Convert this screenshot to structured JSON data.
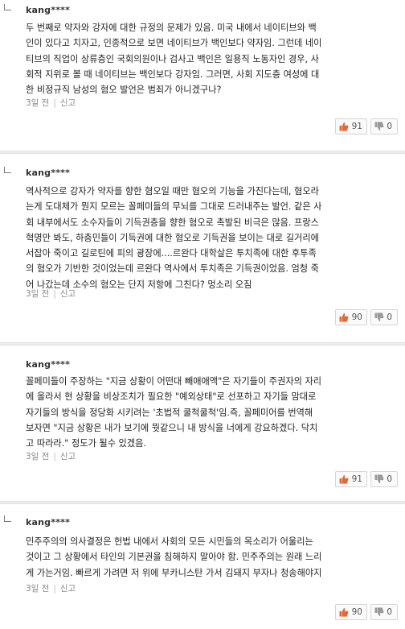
{
  "comments": [
    {
      "author": "kang****",
      "lines": [
        "두 번째로 약자와 강자에 대한 규정의 문제가 있음. 미국 내에서 네이티브와 백",
        "인이 있다고 치자고, 인종적으로 보면 네이티브가 백인보다 약자임. 그런데 네이",
        "티브의 직업이 상류층인 국회의원이나 검사고 백인은 일용직 노동자인 경우, 사",
        "회적 지위로 볼 때 네이티브는 백인보다 강자임. 그러면, 사회 지도층 여성에 대",
        "한 비정규직 남성의 혐오 발언은 범죄가 아니겠구나?"
      ],
      "time": "3일 전",
      "report": "신고",
      "likes": "91",
      "dislikes": "0"
    },
    {
      "author": "kang****",
      "lines": [
        "역사적으로 강자가 약자를 향한 혐오일 때만 혐오의 기능을 가진다는데, 혐오라",
        "는게 도대체가 뭔지 모르는 꼴페미들의 무뇌를 그대로 드러내주는 발언. 같은 사",
        "회 내부에서도 소수자들이 기득권층을 향한 혐오로 촉발된 비극은 많음. 프랑스",
        "혁명만 봐도, 하층민들이 기득권에 대한 혐오로 기득권을 보이는 대로 길거리에",
        "서잡아 죽이고 길로틴에 피의 광장에....르완다 대학살은 투치족에 대한 후투족",
        "의 혐오가 기반한 것이었는데 르완다 역사에서 투치족은 기득권이었음. 엄청 죽",
        "어 나갔는데 소수의 혐오는 단지 저항에 그친다? 멍소리 오짐"
      ],
      "time": "3일 전",
      "report": "신고",
      "likes": "90",
      "dislikes": "0"
    },
    {
      "author": "kang****",
      "lines": [
        "꼴페미들이 주장하는 \"지금 상황이 어떤대 빼애애액\"은 자기들이 주권자의 자리",
        "에 올라서 현 상황을 비상조치가 필요한 \"예외상태\"로 선포하고 자기들 맘대로",
        "자기들의 방식을 정당화 시키려는 '초법적 쿨척쿨척'임.즉, 꼴페미어를 번역해",
        "보자면 \"지금 상황은 내가 보기에 뭣같으니 내 방식을 너에게 강요하겠다. 닥치",
        "고 따라라.\" 정도가 될수 있겠음."
      ],
      "time": "3일 전",
      "report": "신고",
      "likes": "91",
      "dislikes": "0"
    },
    {
      "author": "kang****",
      "lines": [
        "민주주의의 의사결정은 헌법 내에서 사회의 모든 시민들의 목소리가 어울리는",
        "것이고 그 상황에서 타인의 기본권을 침해하지 말아야 함. 민주주의는 원래 느리",
        "게 가는거임. 빠르게 가려면 저 위에 부카니스탄 가서 김돼지 부자나 청송해야지"
      ],
      "time": "3일 전",
      "report": "신고",
      "likes": "90",
      "dislikes": "0"
    }
  ],
  "icons": {
    "like": "thumbs-up-icon",
    "dislike": "thumbs-down-icon",
    "like_color": "#e06a3b",
    "dislike_color": "#9a9a9a"
  }
}
